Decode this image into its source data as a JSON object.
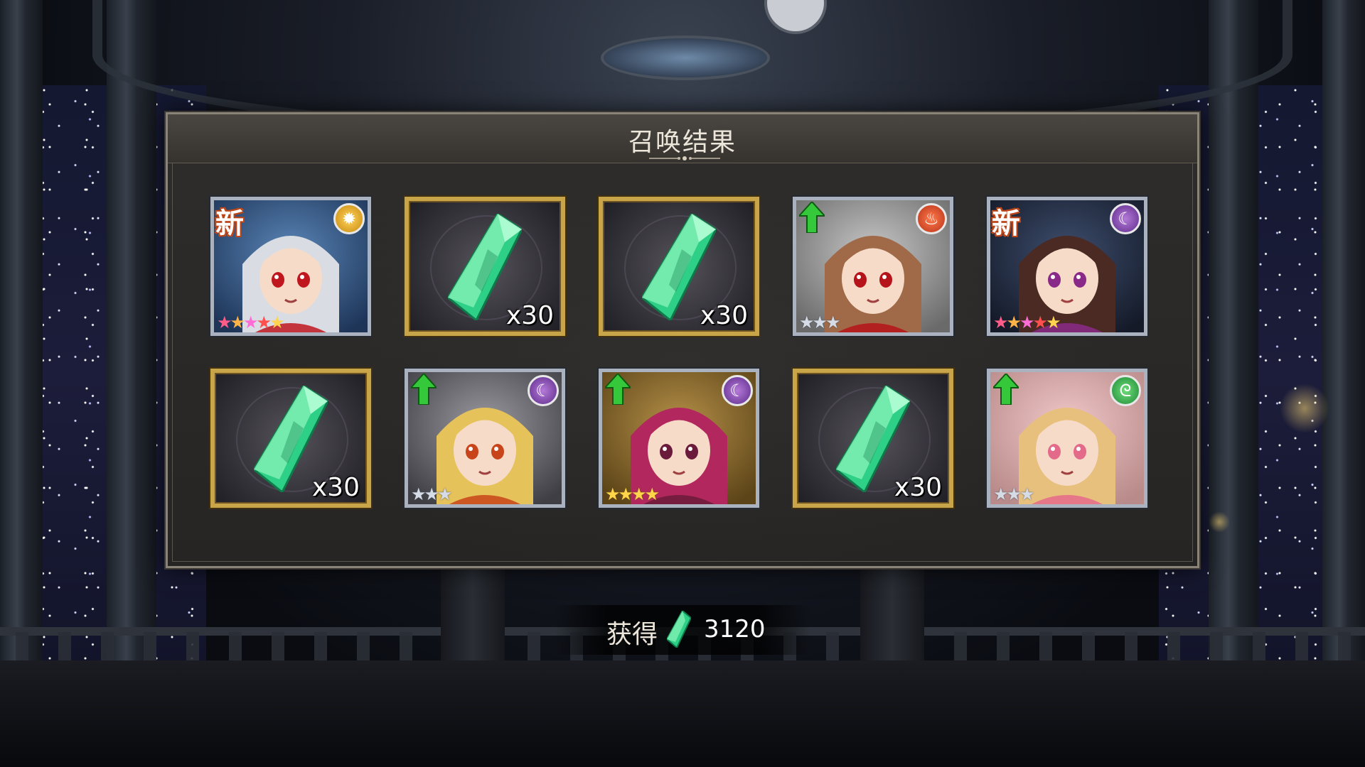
{
  "dialog": {
    "title": "召唤结果"
  },
  "results": [
    {
      "kind": "character",
      "is_new": true,
      "new_label": "新",
      "is_up": false,
      "attribute": "light-attribute-icon",
      "attribute_symbol": "✹",
      "stars": 5,
      "star_style": "rainbow",
      "portrait": {
        "hair": "#d9dde3",
        "bg1": "#5a86b8",
        "bg2": "#1e3558",
        "accent": "#c0161e"
      }
    },
    {
      "kind": "item",
      "item": "green-crystal-icon",
      "qty_label": "x30"
    },
    {
      "kind": "item",
      "item": "green-crystal-icon",
      "qty_label": "x30"
    },
    {
      "kind": "character",
      "is_new": false,
      "new_label": "",
      "is_up": true,
      "attribute": "fire-attribute-icon",
      "attribute_symbol": "♨",
      "stars": 3,
      "star_style": "silver",
      "portrait": {
        "hair": "#a06a48",
        "bg1": "#c7c7c7",
        "bg2": "#6a6a6a",
        "accent": "#b5141a"
      }
    },
    {
      "kind": "character",
      "is_new": true,
      "new_label": "新",
      "is_up": false,
      "attribute": "dark-attribute-icon",
      "attribute_symbol": "☾",
      "stars": 5,
      "star_style": "rainbow",
      "portrait": {
        "hair": "#4a2a22",
        "bg1": "#3e4e6e",
        "bg2": "#141a28",
        "accent": "#8a2a88"
      }
    },
    {
      "kind": "item",
      "item": "green-crystal-icon",
      "qty_label": "x30"
    },
    {
      "kind": "character",
      "is_new": false,
      "new_label": "",
      "is_up": true,
      "attribute": "dark-attribute-icon",
      "attribute_symbol": "☾",
      "stars": 3,
      "star_style": "silver",
      "portrait": {
        "hair": "#e6c25a",
        "bg1": "#9a9aa0",
        "bg2": "#3e3e44",
        "accent": "#c8441a"
      }
    },
    {
      "kind": "character",
      "is_new": false,
      "new_label": "",
      "is_up": true,
      "attribute": "dark-attribute-icon",
      "attribute_symbol": "☾",
      "stars": 4,
      "star_style": "gold",
      "portrait": {
        "hair": "#b2285e",
        "bg1": "#b59048",
        "bg2": "#5c4418",
        "accent": "#6a1a3a"
      }
    },
    {
      "kind": "item",
      "item": "green-crystal-icon",
      "qty_label": "x30"
    },
    {
      "kind": "character",
      "is_new": false,
      "new_label": "",
      "is_up": true,
      "attribute": "wind-attribute-icon",
      "attribute_symbol": "ᘓ",
      "stars": 3,
      "star_style": "silver",
      "portrait": {
        "hair": "#e8c07e",
        "bg1": "#f1c7c7",
        "bg2": "#b88a8a",
        "accent": "#e46a8a"
      }
    }
  ],
  "obtained": {
    "label": "获得",
    "icon": "green-crystal-icon",
    "value": "3120"
  },
  "colors": {
    "crystal_light": "#7ff0b4",
    "crystal_mid": "#2ecf86",
    "crystal_dark": "#0e7a4a",
    "up_arrow": "#35c83a",
    "item_frame": "#c9a54a",
    "char_frame": "#aab2bf"
  }
}
